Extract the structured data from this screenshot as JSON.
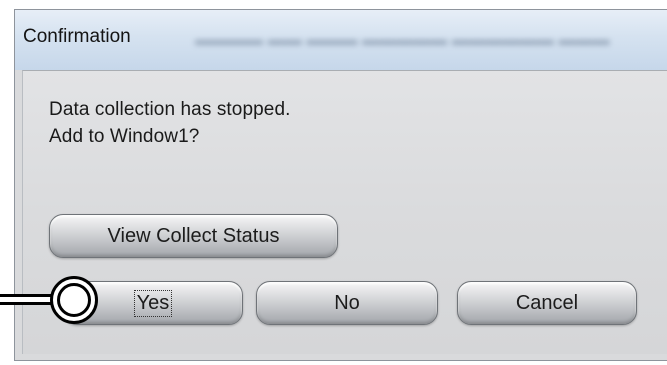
{
  "dialog": {
    "title": "Confirmation",
    "message_lines": [
      "Data collection has stopped.",
      "Add to Window1?"
    ]
  },
  "buttons": {
    "view_status": "View Collect Status",
    "yes": "Yes",
    "no": "No",
    "cancel": "Cancel"
  },
  "callout": {
    "target": "yes-button"
  }
}
